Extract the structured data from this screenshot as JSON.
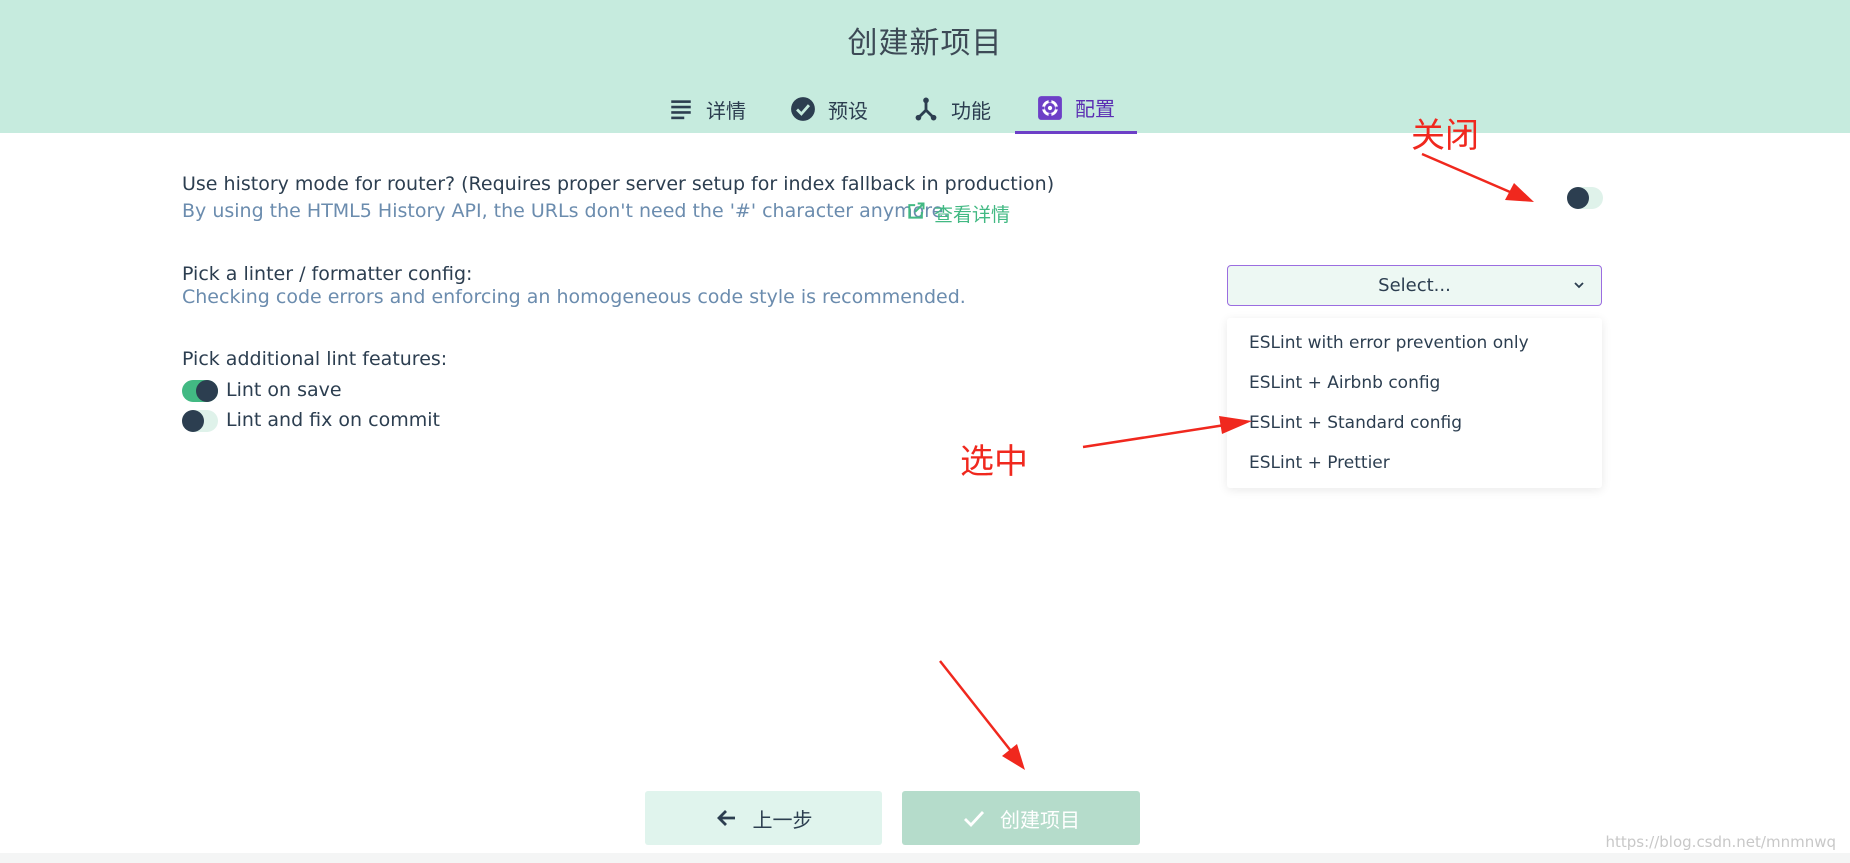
{
  "header": {
    "title": "创建新项目",
    "tabs": [
      {
        "label": "详情",
        "icon": "list-icon",
        "active": false
      },
      {
        "label": "预设",
        "icon": "check-circle-icon",
        "active": false
      },
      {
        "label": "功能",
        "icon": "fork-icon",
        "active": false
      },
      {
        "label": "配置",
        "icon": "gear-icon",
        "active": true
      }
    ]
  },
  "settings": {
    "history_mode": {
      "label": "Use history mode for router? (Requires proper server setup for index fallback in production)",
      "description": "By using the HTML5 History API, the URLs don't need the '#' character anymore.",
      "link_label": "查看详情",
      "enabled": false
    },
    "linter": {
      "label": "Pick a linter / formatter config:",
      "description": "Checking code errors and enforcing an homogeneous code style is recommended.",
      "select_placeholder": "Select...",
      "options": [
        "ESLint with error prevention only",
        "ESLint + Airbnb config",
        "ESLint + Standard config",
        "ESLint + Prettier"
      ]
    },
    "lint_features": {
      "label": "Pick additional lint features:",
      "items": [
        {
          "label": "Lint on save",
          "enabled": true
        },
        {
          "label": "Lint and fix on commit",
          "enabled": false
        }
      ]
    }
  },
  "footer": {
    "back_label": "上一步",
    "create_label": "创建项目"
  },
  "annotations": {
    "close_note": "关闭",
    "select_note": "选中"
  },
  "watermark": "https://blog.csdn.net/mnmnwq",
  "colors": {
    "header_bg": "#c6ebde",
    "accent_purple": "#6d3fc7",
    "link_green": "#42b983",
    "annotation_red": "#f0281e"
  }
}
